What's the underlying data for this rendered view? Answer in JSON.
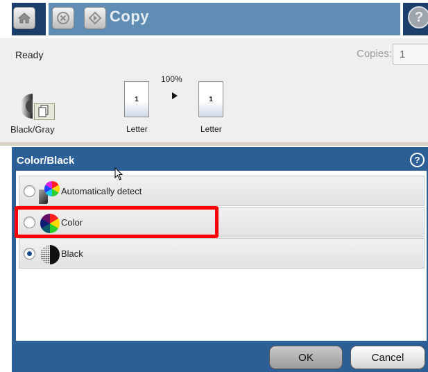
{
  "header": {
    "title": "Copy",
    "home_icon": "home-icon",
    "stop_icon": "stop-icon",
    "start_icon": "start-icon",
    "help_icon": "help-icon"
  },
  "status": {
    "text": "Ready",
    "copies_label": "Copies:",
    "copies_value": "1"
  },
  "summary": {
    "color_mode_label": "Black/Gray",
    "zoom": "100%",
    "original_page_number": "1",
    "original_size": "Letter",
    "output_page_number": "1",
    "output_size": "Letter"
  },
  "dialog": {
    "title": "Color/Black",
    "options": [
      {
        "label": "Automatically detect",
        "selected": false
      },
      {
        "label": "Color",
        "selected": false
      },
      {
        "label": "Black",
        "selected": true
      }
    ],
    "ok_label": "OK",
    "cancel_label": "Cancel"
  },
  "colors": {
    "header_dark": "#1c3e6a",
    "header_blue": "#5f8db4",
    "dialog_blue": "#2d5f97",
    "highlight": "#ff0000"
  }
}
